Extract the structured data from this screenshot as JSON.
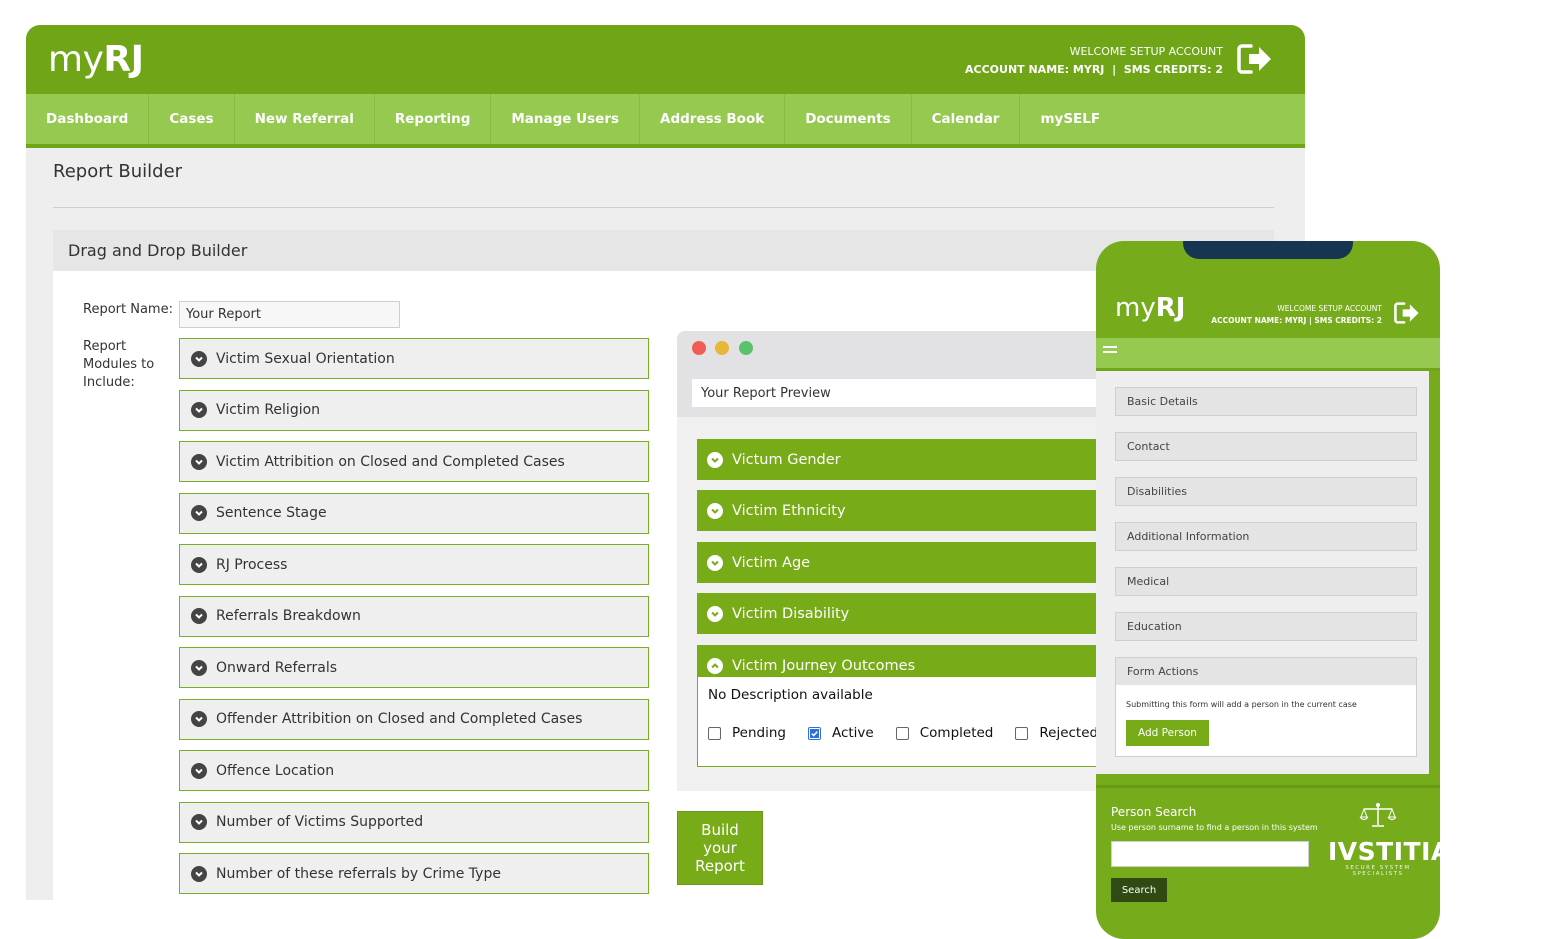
{
  "brand": {
    "logo_prefix": "my",
    "logo_suffix": "RJ",
    "accent": "#6fa516",
    "nav_bg": "#96c94f"
  },
  "account": {
    "welcome": "WELCOME SETUP ACCOUNT",
    "name_label": "ACCOUNT NAME:",
    "name_value": "MYRJ",
    "sep": "|",
    "sms_label": "SMS CREDITS:",
    "sms_value": "2"
  },
  "nav": [
    "Dashboard",
    "Cases",
    "New Referral",
    "Reporting",
    "Manage Users",
    "Address Book",
    "Documents",
    "Calendar",
    "mySELF"
  ],
  "page": {
    "title": "Report Builder"
  },
  "builder": {
    "heading": "Drag and Drop Builder",
    "report_name_label": "Report Name:",
    "report_name_value": "Your Report",
    "modules_label_1": "Report",
    "modules_label_2": "Modules to",
    "modules_label_3": "Include:",
    "modules": [
      "Victim Sexual Orientation",
      "Victim Religion",
      "Victim Attribition on Closed and Completed Cases",
      "Sentence Stage",
      "RJ Process",
      "Referrals Breakdown",
      "Onward Referrals",
      "Offender Attribition on Closed and Completed Cases",
      "Offence Location",
      "Number of Victims Supported",
      "Number of these referrals by Crime Type"
    ],
    "build_button": "Build your Report"
  },
  "preview": {
    "title": "Your Report Preview",
    "modules": [
      "Victum Gender",
      "Victim Ethnicity",
      "Victim Age",
      "Victim Disability",
      "Victim Journey Outcomes"
    ],
    "no_description": "No Description available",
    "statuses": [
      {
        "label": "Pending",
        "checked": false
      },
      {
        "label": "Active",
        "checked": true
      },
      {
        "label": "Completed",
        "checked": false
      },
      {
        "label": "Rejected",
        "checked": false
      }
    ]
  },
  "mobile": {
    "sections": [
      "Basic Details",
      "Contact",
      "Disabilities",
      "Additional Information",
      "Medical",
      "Education",
      "Form Actions"
    ],
    "form_note": "Submitting this form will add a person in the current case",
    "add_button": "Add Person",
    "search_title": "Person Search",
    "search_hint": "Use person surname to find a person in this system",
    "search_button": "Search",
    "partner_name": "IVSTITIA",
    "partner_tagline": "SECURE SYSTEM SPECIALISTS"
  }
}
